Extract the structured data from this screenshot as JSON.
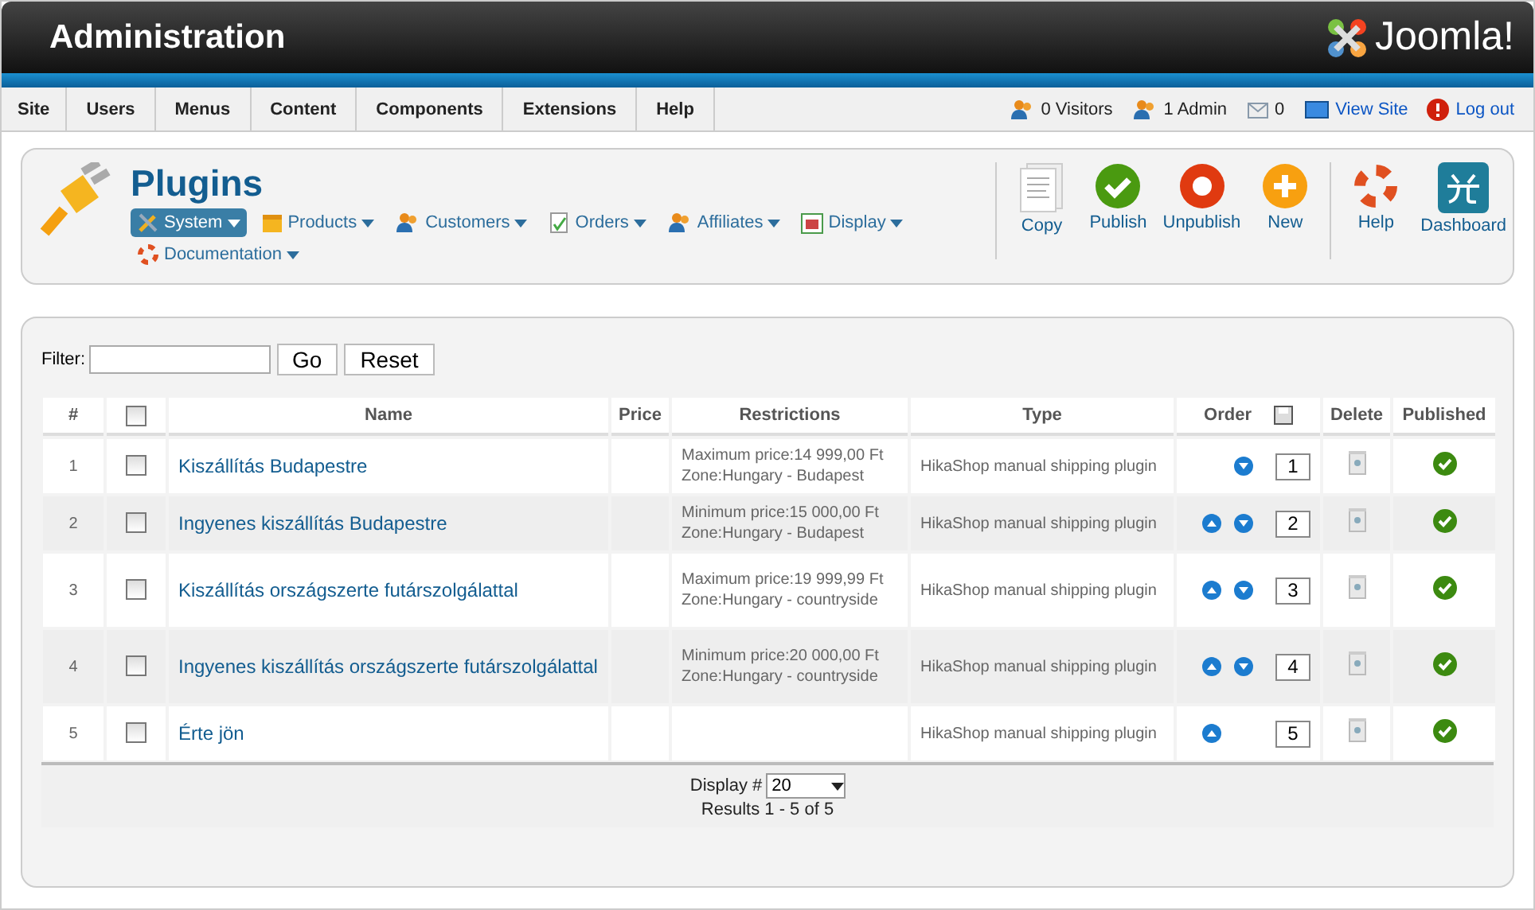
{
  "header": {
    "title": "Administration",
    "logo": "Joomla!"
  },
  "menu": [
    {
      "label": "Site"
    },
    {
      "label": "Users"
    },
    {
      "label": "Menus"
    },
    {
      "label": "Content"
    },
    {
      "label": "Components"
    },
    {
      "label": "Extensions"
    },
    {
      "label": "Help"
    }
  ],
  "status": [
    {
      "kind": "visitors",
      "label": "0 Visitors"
    },
    {
      "kind": "admin",
      "label": "1 Admin"
    },
    {
      "kind": "messages",
      "label": "0"
    },
    {
      "kind": "viewsite",
      "label": "View Site"
    },
    {
      "kind": "logout",
      "label": "Log out"
    }
  ],
  "page_title": "Plugins",
  "submenu": [
    {
      "kind": "system",
      "label": "System",
      "selected": true
    },
    {
      "kind": "products",
      "label": "Products",
      "selected": false
    },
    {
      "kind": "customers",
      "label": "Customers",
      "selected": false
    },
    {
      "kind": "orders",
      "label": "Orders",
      "selected": false
    },
    {
      "kind": "affiliates",
      "label": "Affiliates",
      "selected": false
    },
    {
      "kind": "display",
      "label": "Display",
      "selected": false
    },
    {
      "kind": "documentation",
      "label": "Documentation",
      "selected": false
    }
  ],
  "toolbar": [
    {
      "kind": "copy",
      "label": "Copy"
    },
    {
      "kind": "publish",
      "label": "Publish"
    },
    {
      "kind": "unpublish",
      "label": "Unpublish"
    },
    {
      "kind": "new",
      "label": "New"
    },
    {
      "kind": "help",
      "label": "Help"
    },
    {
      "kind": "dashboard",
      "label": "Dashboard"
    }
  ],
  "filter": {
    "label": "Filter:",
    "go": "Go",
    "reset": "Reset"
  },
  "table": {
    "select_all_checked": false,
    "columns": [
      "#",
      "Name",
      "Price",
      "Restrictions",
      "Type",
      "Order",
      "Delete",
      "Published"
    ],
    "rows": [
      {
        "num": "1",
        "checked": false,
        "name": "Kiszállítás Budapestre",
        "restrictions": [
          "Maximum price:14 999,00 Ft",
          "Zone:Hungary - Budapest"
        ],
        "type": "HikaShop manual shipping plugin",
        "up": false,
        "down": true,
        "order": "1",
        "published": true
      },
      {
        "num": "2",
        "checked": false,
        "name": "Ingyenes kiszállítás Budapestre",
        "restrictions": [
          "Minimum price:15 000,00 Ft",
          "Zone:Hungary - Budapest"
        ],
        "type": "HikaShop manual shipping plugin",
        "up": true,
        "down": true,
        "order": "2",
        "published": true
      },
      {
        "num": "3",
        "checked": false,
        "name": "Kiszállítás országszerte futárszolgálattal",
        "restrictions": [
          "Maximum price:19 999,99 Ft",
          "Zone:Hungary - countryside"
        ],
        "type": "HikaShop manual shipping plugin",
        "up": true,
        "down": true,
        "order": "3",
        "published": true
      },
      {
        "num": "4",
        "checked": false,
        "name": "Ingyenes kiszállítás országszerte futárszolgálattal",
        "restrictions": [
          "Minimum price:20 000,00 Ft",
          "Zone:Hungary - countryside"
        ],
        "type": "HikaShop manual shipping plugin",
        "up": true,
        "down": true,
        "order": "4",
        "published": true
      },
      {
        "num": "5",
        "checked": false,
        "name": "Érte jön",
        "restrictions": [],
        "type": "HikaShop manual shipping plugin",
        "up": true,
        "down": false,
        "order": "5",
        "published": true
      }
    ]
  },
  "pagination": {
    "label": "Display #",
    "value": "20",
    "results": "Results 1 - 5 of 5"
  }
}
